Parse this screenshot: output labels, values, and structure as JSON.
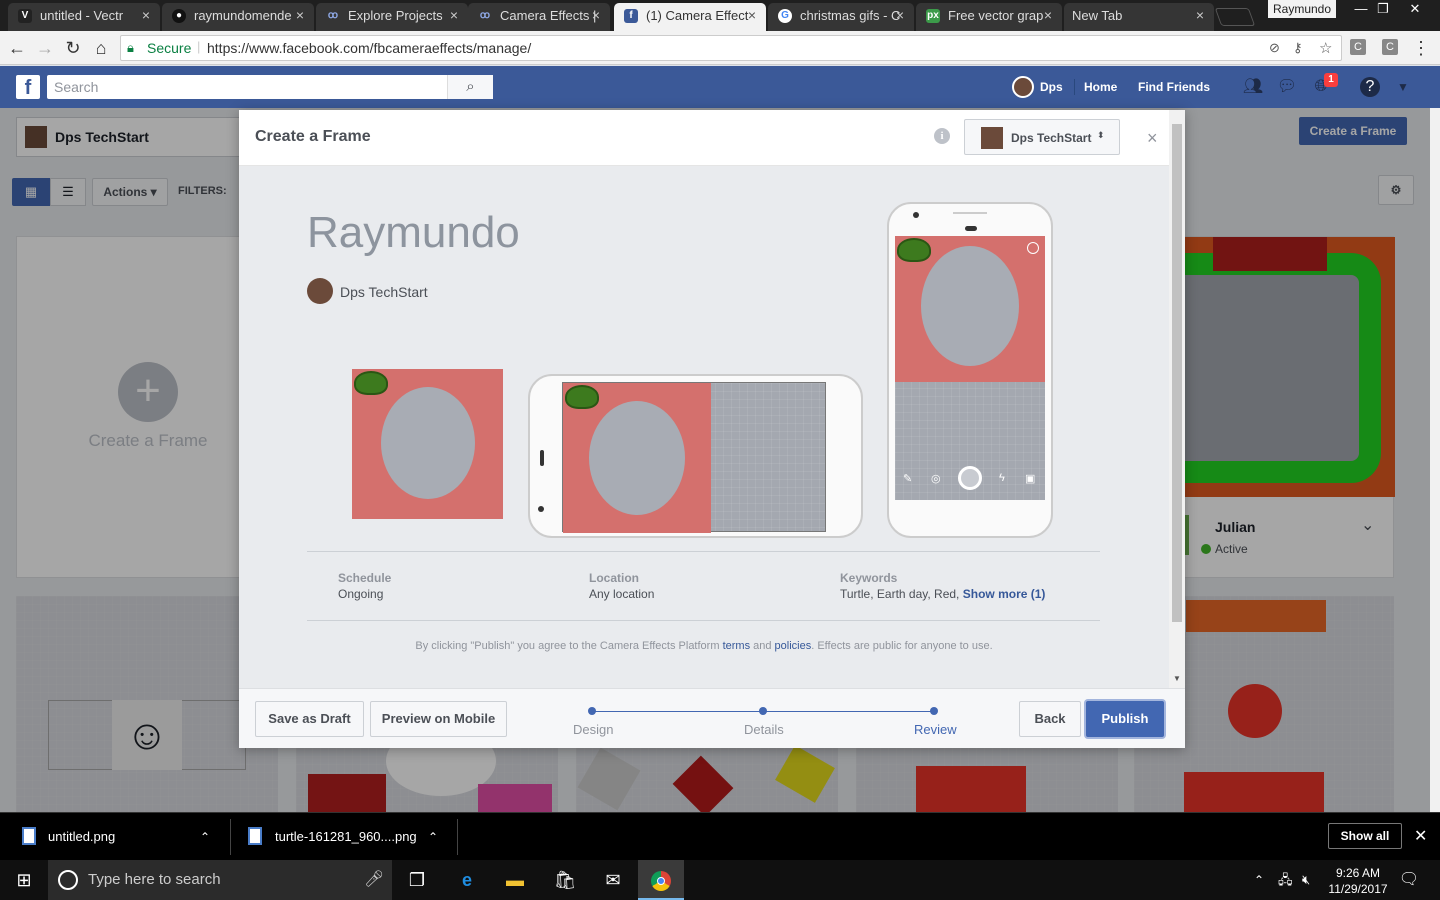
{
  "browser": {
    "tabs": [
      {
        "label": "untitled - Vectr",
        "icon": "vectr-icon"
      },
      {
        "label": "raymundomende",
        "icon": "github-icon"
      },
      {
        "label": "Explore Projects",
        "icon": "camera-effects-icon"
      },
      {
        "label": "Camera Effects |",
        "icon": "camera-effects-icon"
      },
      {
        "label": "(1) Camera Effect",
        "icon": "facebook-icon"
      },
      {
        "label": "christmas gifs - C",
        "icon": "google-icon"
      },
      {
        "label": "Free vector grap",
        "icon": "px-icon"
      },
      {
        "label": "New Tab",
        "icon": ""
      }
    ],
    "profile": "Raymundo",
    "secure_label": "Secure",
    "url": "https://www.facebook.com/fbcameraeffects/manage/"
  },
  "fb": {
    "search_placeholder": "Search",
    "user": "Dps",
    "home": "Home",
    "find_friends": "Find Friends",
    "notif_count": "1"
  },
  "page": {
    "account": "Dps TechStart",
    "create_frame": "Create a Frame",
    "actions": "Actions",
    "filters": "FILTERS:",
    "create_card": "Create a Frame",
    "julian": "Julian",
    "active": "Active"
  },
  "modal": {
    "title": "Create a Frame",
    "account": "Dps TechStart",
    "frame_name": "Raymundo",
    "owner": "Dps TechStart",
    "schedule_label": "Schedule",
    "schedule_value": "Ongoing",
    "location_label": "Location",
    "location_value": "Any location",
    "keywords_label": "Keywords",
    "keywords_value": "Turtle, Earth day, Red,",
    "show_more": "Show more (1)",
    "terms_pre": "By clicking \"Publish\" you agree to the Camera Effects Platform",
    "terms_link": "terms",
    "and": "and",
    "policies_link": "policies",
    "terms_post": ". Effects are public for anyone to use.",
    "save_draft": "Save as Draft",
    "preview_mobile": "Preview on Mobile",
    "steps": [
      "Design",
      "Details",
      "Review"
    ],
    "back": "Back",
    "publish": "Publish"
  },
  "downloads": {
    "file1": "untitled.png",
    "file2": "turtle-161281_960....png",
    "show_all": "Show all"
  },
  "taskbar": {
    "search_placeholder": "Type here to search",
    "time": "9:26 AM",
    "date": "11/29/2017"
  }
}
